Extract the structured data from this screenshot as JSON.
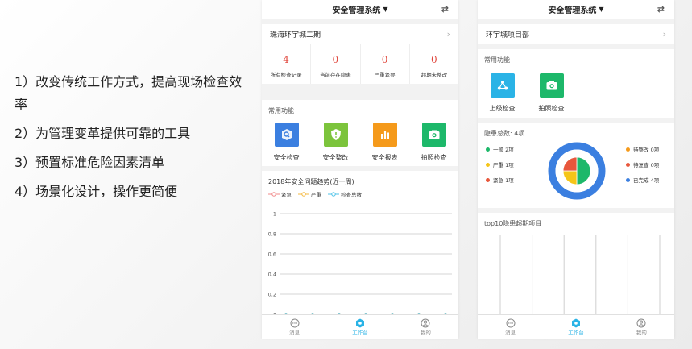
{
  "bullets": [
    "1）改变传统工作方式，提高现场检查效率",
    "2）为管理变革提供可靠的工具",
    "3）预置标准危险因素清单",
    "4）场景化设计，操作更简便"
  ],
  "phone1": {
    "title": "安全管理系统",
    "project": "珠海环宇城二期",
    "stats": [
      {
        "value": "4",
        "label": "所有检查记录"
      },
      {
        "value": "0",
        "label": "当前存在隐患"
      },
      {
        "value": "0",
        "label": "严重紧要"
      },
      {
        "value": "0",
        "label": "超期未整改"
      }
    ],
    "functions_title": "常用功能",
    "functions": [
      {
        "label": "安全检查",
        "color": "#3b7fe0",
        "icon": "search-icon"
      },
      {
        "label": "安全整改",
        "color": "#7cc43c",
        "icon": "shield-icon"
      },
      {
        "label": "安全报表",
        "color": "#f59a1b",
        "icon": "bar-chart-icon"
      },
      {
        "label": "拍照检查",
        "color": "#1db86a",
        "icon": "camera-icon"
      }
    ],
    "nav": [
      {
        "label": "消息",
        "icon": "message-icon"
      },
      {
        "label": "工作台",
        "icon": "workbench-icon"
      },
      {
        "label": "我的",
        "icon": "profile-icon"
      }
    ]
  },
  "phone2": {
    "title": "安全管理系统",
    "project": "环宇城项目部",
    "functions_title": "常用功能",
    "functions": [
      {
        "label": "上级检查",
        "color": "#2ab3e6",
        "icon": "share-icon"
      },
      {
        "label": "拍照检查",
        "color": "#1db86a",
        "icon": "camera-icon"
      }
    ],
    "hazard_total": "隐患总数: 4项",
    "legend_left": [
      {
        "label": "一般 2项",
        "color": "#1db86a"
      },
      {
        "label": "严重 1项",
        "color": "#f5c518"
      },
      {
        "label": "紧急 1项",
        "color": "#e8573c"
      }
    ],
    "legend_right": [
      {
        "label": "待整改 0项",
        "color": "#f59a1b"
      },
      {
        "label": "待复查 0项",
        "color": "#e8573c"
      },
      {
        "label": "已完成 4项",
        "color": "#3b7fe0"
      }
    ],
    "top10_title": "top10隐患超期项目",
    "nav": [
      {
        "label": "消息",
        "icon": "message-icon"
      },
      {
        "label": "工作台",
        "icon": "workbench-icon"
      },
      {
        "label": "我的",
        "icon": "profile-icon"
      }
    ]
  },
  "chart_data": [
    {
      "type": "line",
      "title": "2018年安全问题趋势(近一周)",
      "series": [
        {
          "name": "紧急",
          "color": "#f08a8a",
          "values": [
            0,
            0,
            0,
            0,
            0,
            0,
            0
          ]
        },
        {
          "name": "严重",
          "color": "#f5b941",
          "values": [
            0,
            0,
            0,
            0,
            0,
            0,
            0
          ]
        },
        {
          "name": "检查总数",
          "color": "#4fc3e8",
          "values": [
            0,
            0,
            0,
            0,
            0,
            0,
            0
          ]
        }
      ],
      "y_ticks": [
        "1",
        "0.8",
        "0.6",
        "0.4",
        "0.2",
        "0"
      ],
      "ylim": [
        0,
        1
      ],
      "grid": true
    },
    {
      "type": "pie",
      "slices": [
        {
          "name": "一般",
          "value": 2,
          "color": "#1db86a"
        },
        {
          "name": "严重",
          "value": 1,
          "color": "#f5c518"
        },
        {
          "name": "紧急",
          "value": 1,
          "color": "#e8573c"
        }
      ],
      "ring": {
        "name": "已完成",
        "value": 4,
        "color": "#3b7fe0"
      }
    },
    {
      "type": "bar",
      "title": "top10隐患超期项目",
      "categories": [
        "",
        "",
        "",
        "",
        "",
        ""
      ],
      "values": [
        1,
        1,
        1,
        1,
        1,
        1
      ],
      "ylim": [
        0,
        1
      ]
    }
  ]
}
